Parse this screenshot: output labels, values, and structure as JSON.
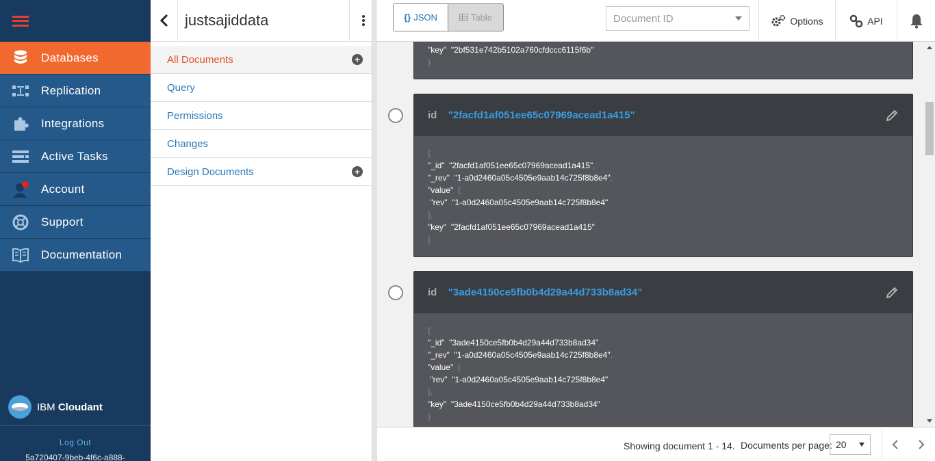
{
  "nav": {
    "items": [
      {
        "label": "Databases",
        "icon": "database-icon",
        "active": true
      },
      {
        "label": "Replication",
        "icon": "replication-icon",
        "active": false
      },
      {
        "label": "Integrations",
        "icon": "puzzle-icon",
        "active": false
      },
      {
        "label": "Active Tasks",
        "icon": "tasks-icon",
        "active": false
      },
      {
        "label": "Account",
        "icon": "account-icon",
        "active": false
      },
      {
        "label": "Support",
        "icon": "lifebuoy-icon",
        "active": false
      },
      {
        "label": "Documentation",
        "icon": "book-icon",
        "active": false
      }
    ],
    "brand_ibm": "IBM",
    "brand_name": "Cloudant",
    "logout": "Log Out",
    "account_id": "5a720407-9beb-4f6c-a888-"
  },
  "db": {
    "title": "justsajiddata",
    "items": [
      {
        "label": "All Documents",
        "active": true,
        "plus": true
      },
      {
        "label": "Query",
        "active": false,
        "plus": false
      },
      {
        "label": "Permissions",
        "active": false,
        "plus": false
      },
      {
        "label": "Changes",
        "active": false,
        "plus": false
      },
      {
        "label": "Design Documents",
        "active": false,
        "plus": true
      }
    ]
  },
  "toolbar": {
    "json_label": "JSON",
    "table_label": "Table",
    "doc_id_placeholder": "Document ID",
    "options_label": "Options",
    "api_label": "API"
  },
  "docs": {
    "id_label": "id",
    "partial_key_line": "\"key\"  \"2bf531e742b5102a760cfdccc6115f6b\"",
    "cards": [
      {
        "id": "\"2facfd1af051ee65c07969acead1a415\"",
        "_id": "\"2facfd1af051ee65c07969acead1a415\"",
        "_rev": "\"1-a0d2460a05c4505e9aab14c725f8b8e4\"",
        "rev": "\"1-a0d2460a05c4505e9aab14c725f8b8e4\"",
        "key": "\"2facfd1af051ee65c07969acead1a415\""
      },
      {
        "id": "\"3ade4150ce5fb0b4d29a44d733b8ad34\"",
        "_id": "\"3ade4150ce5fb0b4d29a44d733b8ad34\"",
        "_rev": "\"1-a0d2460a05c4505e9aab14c725f8b8e4\"",
        "rev": "\"1-a0d2460a05c4505e9aab14c725f8b8e4\"",
        "key": "\"3ade4150ce5fb0b4d29a44d733b8ad34\""
      }
    ],
    "keys": {
      "_id": "\"_id\"",
      "_rev": "\"_rev\"",
      "value": "\"value\"",
      "rev": "\"rev\"",
      "key": "\"key\""
    }
  },
  "footer": {
    "showing": "Showing document 1 - 14.",
    "per_page_label": "Documents per page:",
    "per_page_value": "20"
  },
  "colors": {
    "nav_bg": "#183a5e",
    "nav_item_bg": "#24598a",
    "active_orange": "#f1692e",
    "link_blue": "#2a78b7",
    "card_bg": "#54565b",
    "card_head": "#3a3d42",
    "id_blue": "#3c9be0"
  }
}
